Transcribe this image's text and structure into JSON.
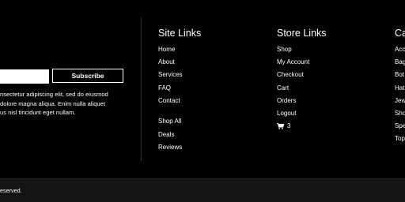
{
  "newsletter": {
    "email_placeholder": "",
    "subscribe_label": "Subscribe",
    "blurb_lines": [
      "nsectetur adipiscing elit, sed do eiusmod",
      "dolore magna aliqua. Enim nulla aliquet",
      "us nisl tincidunt eget nullam."
    ]
  },
  "site_links": {
    "title": "Site Links",
    "group1": [
      "Home",
      "About",
      "Services",
      "FAQ",
      "Contact"
    ],
    "group2": [
      "Shop All",
      "Deals",
      "Reviews"
    ]
  },
  "store_links": {
    "title": "Store Links",
    "items": [
      "Shop",
      "My Account",
      "Checkout",
      "Cart",
      "Orders",
      "Logout"
    ],
    "cart_icon": "shopping-cart-icon",
    "cart_count": "3"
  },
  "categories": {
    "title": "Ca",
    "items": [
      "Acc",
      "Bag",
      "Bot",
      "Hat",
      "Jew",
      "Sho",
      "Spe",
      "Top"
    ]
  },
  "bottom": {
    "copyright": "eserved."
  },
  "colors": {
    "background": "#000000",
    "text": "#ffffff",
    "bottom_bar": "#141414"
  }
}
